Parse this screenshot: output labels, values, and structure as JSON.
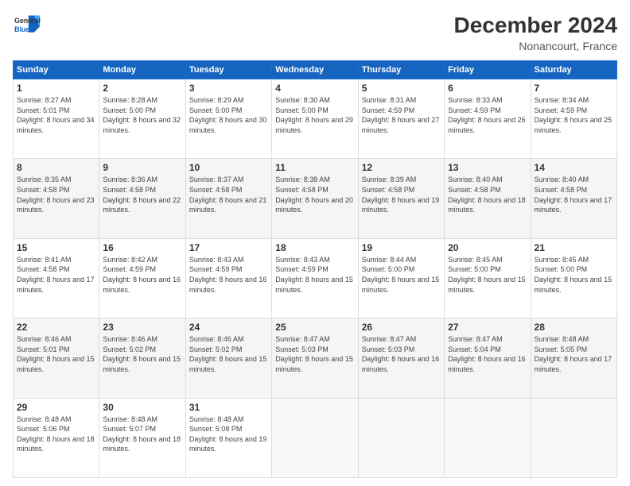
{
  "logo": {
    "line1": "General",
    "line2": "Blue"
  },
  "title": "December 2024",
  "subtitle": "Nonancourt, France",
  "headers": [
    "Sunday",
    "Monday",
    "Tuesday",
    "Wednesday",
    "Thursday",
    "Friday",
    "Saturday"
  ],
  "weeks": [
    [
      {
        "day": "1",
        "sunrise": "8:27 AM",
        "sunset": "5:01 PM",
        "daylight": "8 hours and 34 minutes."
      },
      {
        "day": "2",
        "sunrise": "8:28 AM",
        "sunset": "5:00 PM",
        "daylight": "8 hours and 32 minutes."
      },
      {
        "day": "3",
        "sunrise": "8:29 AM",
        "sunset": "5:00 PM",
        "daylight": "8 hours and 30 minutes."
      },
      {
        "day": "4",
        "sunrise": "8:30 AM",
        "sunset": "5:00 PM",
        "daylight": "8 hours and 29 minutes."
      },
      {
        "day": "5",
        "sunrise": "8:31 AM",
        "sunset": "4:59 PM",
        "daylight": "8 hours and 27 minutes."
      },
      {
        "day": "6",
        "sunrise": "8:33 AM",
        "sunset": "4:59 PM",
        "daylight": "8 hours and 26 minutes."
      },
      {
        "day": "7",
        "sunrise": "8:34 AM",
        "sunset": "4:59 PM",
        "daylight": "8 hours and 25 minutes."
      }
    ],
    [
      {
        "day": "8",
        "sunrise": "8:35 AM",
        "sunset": "4:58 PM",
        "daylight": "8 hours and 23 minutes."
      },
      {
        "day": "9",
        "sunrise": "8:36 AM",
        "sunset": "4:58 PM",
        "daylight": "8 hours and 22 minutes."
      },
      {
        "day": "10",
        "sunrise": "8:37 AM",
        "sunset": "4:58 PM",
        "daylight": "8 hours and 21 minutes."
      },
      {
        "day": "11",
        "sunrise": "8:38 AM",
        "sunset": "4:58 PM",
        "daylight": "8 hours and 20 minutes."
      },
      {
        "day": "12",
        "sunrise": "8:39 AM",
        "sunset": "4:58 PM",
        "daylight": "8 hours and 19 minutes."
      },
      {
        "day": "13",
        "sunrise": "8:40 AM",
        "sunset": "4:58 PM",
        "daylight": "8 hours and 18 minutes."
      },
      {
        "day": "14",
        "sunrise": "8:40 AM",
        "sunset": "4:58 PM",
        "daylight": "8 hours and 17 minutes."
      }
    ],
    [
      {
        "day": "15",
        "sunrise": "8:41 AM",
        "sunset": "4:58 PM",
        "daylight": "8 hours and 17 minutes."
      },
      {
        "day": "16",
        "sunrise": "8:42 AM",
        "sunset": "4:59 PM",
        "daylight": "8 hours and 16 minutes."
      },
      {
        "day": "17",
        "sunrise": "8:43 AM",
        "sunset": "4:59 PM",
        "daylight": "8 hours and 16 minutes."
      },
      {
        "day": "18",
        "sunrise": "8:43 AM",
        "sunset": "4:59 PM",
        "daylight": "8 hours and 15 minutes."
      },
      {
        "day": "19",
        "sunrise": "8:44 AM",
        "sunset": "5:00 PM",
        "daylight": "8 hours and 15 minutes."
      },
      {
        "day": "20",
        "sunrise": "8:45 AM",
        "sunset": "5:00 PM",
        "daylight": "8 hours and 15 minutes."
      },
      {
        "day": "21",
        "sunrise": "8:45 AM",
        "sunset": "5:00 PM",
        "daylight": "8 hours and 15 minutes."
      }
    ],
    [
      {
        "day": "22",
        "sunrise": "8:46 AM",
        "sunset": "5:01 PM",
        "daylight": "8 hours and 15 minutes."
      },
      {
        "day": "23",
        "sunrise": "8:46 AM",
        "sunset": "5:02 PM",
        "daylight": "8 hours and 15 minutes."
      },
      {
        "day": "24",
        "sunrise": "8:46 AM",
        "sunset": "5:02 PM",
        "daylight": "8 hours and 15 minutes."
      },
      {
        "day": "25",
        "sunrise": "8:47 AM",
        "sunset": "5:03 PM",
        "daylight": "8 hours and 15 minutes."
      },
      {
        "day": "26",
        "sunrise": "8:47 AM",
        "sunset": "5:03 PM",
        "daylight": "8 hours and 16 minutes."
      },
      {
        "day": "27",
        "sunrise": "8:47 AM",
        "sunset": "5:04 PM",
        "daylight": "8 hours and 16 minutes."
      },
      {
        "day": "28",
        "sunrise": "8:48 AM",
        "sunset": "5:05 PM",
        "daylight": "8 hours and 17 minutes."
      }
    ],
    [
      {
        "day": "29",
        "sunrise": "8:48 AM",
        "sunset": "5:06 PM",
        "daylight": "8 hours and 18 minutes."
      },
      {
        "day": "30",
        "sunrise": "8:48 AM",
        "sunset": "5:07 PM",
        "daylight": "8 hours and 18 minutes."
      },
      {
        "day": "31",
        "sunrise": "8:48 AM",
        "sunset": "5:08 PM",
        "daylight": "8 hours and 19 minutes."
      },
      null,
      null,
      null,
      null
    ]
  ]
}
